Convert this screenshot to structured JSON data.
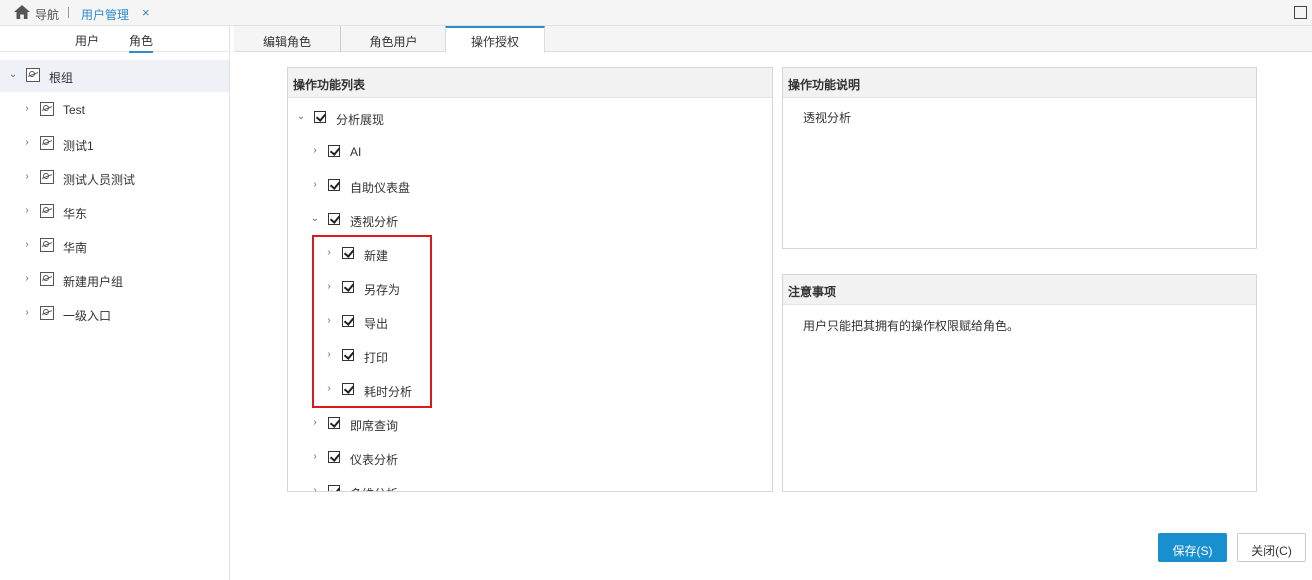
{
  "topbar": {
    "nav_label": "导航",
    "tab_title": "用户管理",
    "tab_close": "×"
  },
  "left": {
    "tabs": {
      "user": "用户",
      "role": "角色"
    },
    "tree": [
      {
        "label": "根组",
        "expanded": true
      },
      {
        "label": "Test"
      },
      {
        "label": "测试1"
      },
      {
        "label": "测试人员测试"
      },
      {
        "label": "华东"
      },
      {
        "label": "华南"
      },
      {
        "label": "新建用户组"
      },
      {
        "label": "一级入口"
      }
    ]
  },
  "tabs": {
    "edit_role": "编辑角色",
    "role_users": "角色用户",
    "op_auth": "操作授权"
  },
  "perm_list": {
    "title": "操作功能列表",
    "items": [
      {
        "label": "分析展现",
        "level": 0,
        "expanded": true,
        "checked": true
      },
      {
        "label": "AI",
        "level": 1,
        "checked": true
      },
      {
        "label": "自助仪表盘",
        "level": 1,
        "checked": true
      },
      {
        "label": "透视分析",
        "level": 1,
        "expanded": true,
        "checked": true
      },
      {
        "label": "新建",
        "level": 2,
        "checked": true
      },
      {
        "label": "另存为",
        "level": 2,
        "checked": true
      },
      {
        "label": "导出",
        "level": 2,
        "checked": true
      },
      {
        "label": "打印",
        "level": 2,
        "checked": true
      },
      {
        "label": "耗时分析",
        "level": 2,
        "checked": true
      },
      {
        "label": "即席查询",
        "level": 1,
        "checked": true
      },
      {
        "label": "仪表分析",
        "level": 1,
        "checked": true
      },
      {
        "label": "多维分析",
        "level": 1,
        "checked": true
      }
    ]
  },
  "desc": {
    "title": "操作功能说明",
    "text": "透视分析"
  },
  "notes": {
    "title": "注意事项",
    "text": "用户只能把其拥有的操作权限赋给角色。"
  },
  "buttons": {
    "save": "保存(S)",
    "close": "关闭(C)"
  },
  "colors": {
    "accent": "#2f8ccf",
    "primary_button": "#1a8fcf",
    "highlight": "#d9191c"
  }
}
